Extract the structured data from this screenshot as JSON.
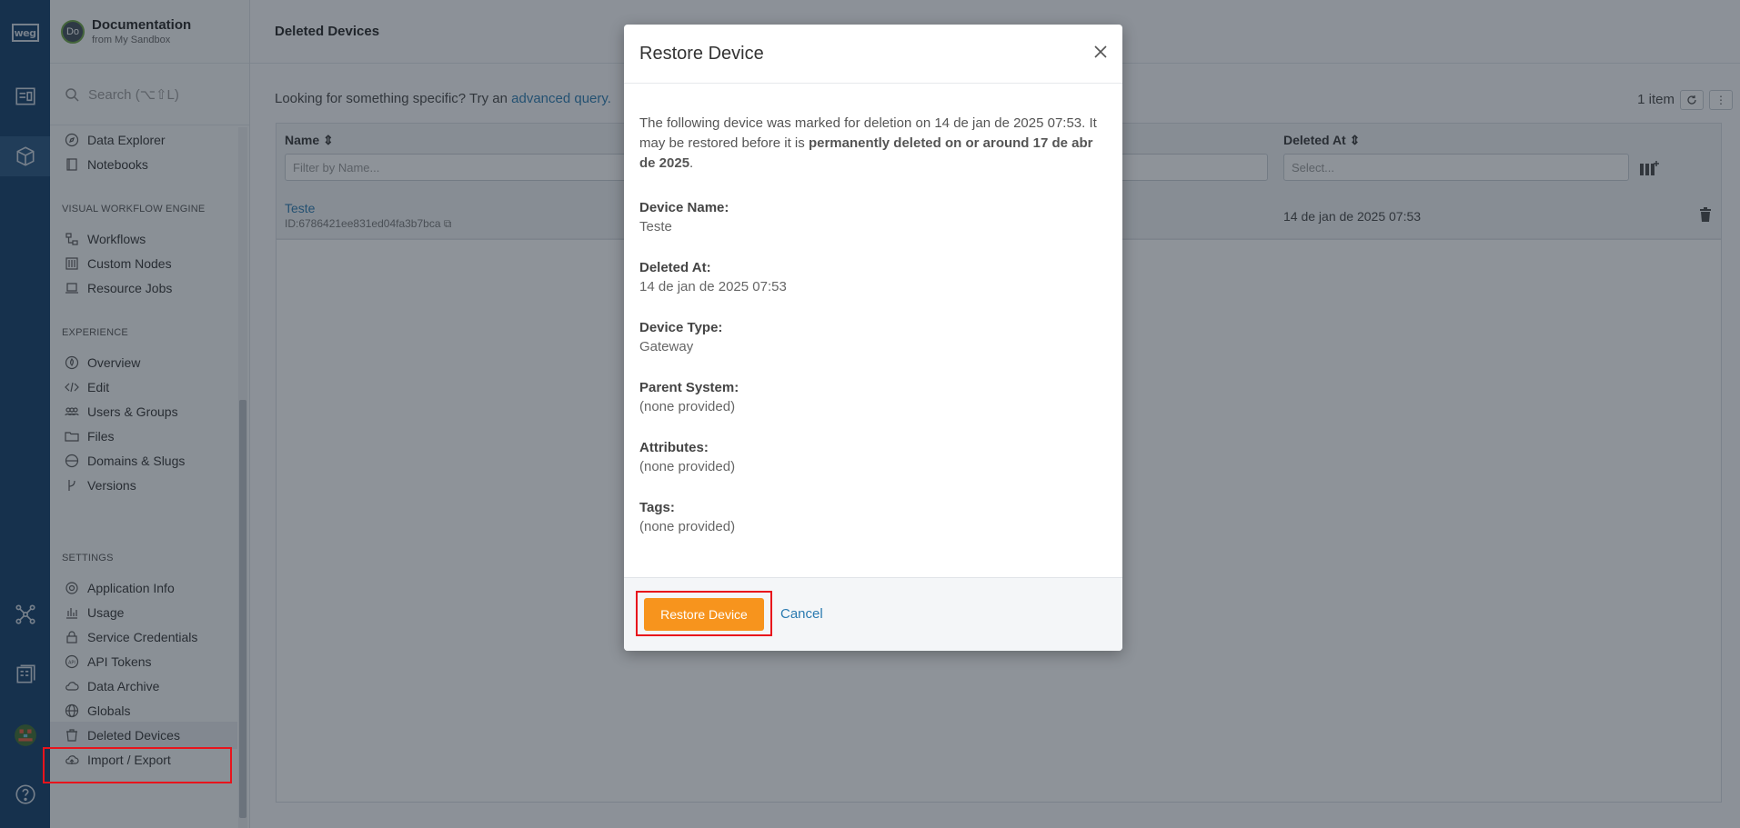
{
  "rail": {
    "logo": "weg",
    "items": [
      "dashboard-icon",
      "device-cube-icon",
      "network-icon",
      "building-icon",
      "user-avatar",
      "help-icon"
    ]
  },
  "sidebar": {
    "app_avatar": "Do",
    "app_title": "Documentation",
    "app_sub": "from My Sandbox",
    "search_placeholder": "Search (⌥⇧L)",
    "items": {
      "data_explorer": "Data Explorer",
      "notebooks": "Notebooks",
      "workflows": "Workflows",
      "custom_nodes": "Custom Nodes",
      "resource_jobs": "Resource Jobs",
      "overview": "Overview",
      "edit": "Edit",
      "users_groups": "Users & Groups",
      "files": "Files",
      "domains_slugs": "Domains & Slugs",
      "versions": "Versions",
      "application_info": "Application Info",
      "usage": "Usage",
      "service_credentials": "Service Credentials",
      "api_tokens": "API Tokens",
      "data_archive": "Data Archive",
      "globals": "Globals",
      "deleted_devices": "Deleted Devices",
      "import_export": "Import / Export"
    },
    "sections": {
      "vwe": "VISUAL WORKFLOW ENGINE",
      "experience": "EXPERIENCE",
      "settings": "SETTINGS"
    }
  },
  "main": {
    "title": "Deleted Devices",
    "query_prefix": "Looking for something specific? Try an",
    "query_link": "advanced query.",
    "item_count": "1 item",
    "columns": {
      "name": "Name",
      "deleted_at": "Deleted At",
      "name_filter_placeholder": "Filter by Name...",
      "deleted_filter_placeholder": "Select..."
    },
    "rows": [
      {
        "name": "Teste",
        "id": "ID:6786421ee831ed04fa3b7bca",
        "deleted_at": "14 de jan de 2025 07:53"
      }
    ]
  },
  "modal": {
    "title": "Restore Device",
    "intro_1": "The following device was marked for deletion on 14 de jan de 2025 07:53. It may be restored before it is",
    "intro_bold": "permanently deleted on or around 17 de abr de 2025",
    "intro_end": ".",
    "fields": [
      {
        "label": "Device Name:",
        "value": "Teste"
      },
      {
        "label": "Deleted At:",
        "value": "14 de jan de 2025 07:53"
      },
      {
        "label": "Device Type:",
        "value": "Gateway"
      },
      {
        "label": "Parent System:",
        "value": "(none provided)"
      },
      {
        "label": "Attributes:",
        "value": "(none provided)"
      },
      {
        "label": "Tags:",
        "value": "(none provided)"
      }
    ],
    "restore_label": "Restore Device",
    "cancel_label": "Cancel"
  },
  "colors": {
    "rail": "#0e3a66",
    "accent_orange": "#f7941d",
    "link": "#2a7ab0",
    "highlight": "#e8141c"
  }
}
